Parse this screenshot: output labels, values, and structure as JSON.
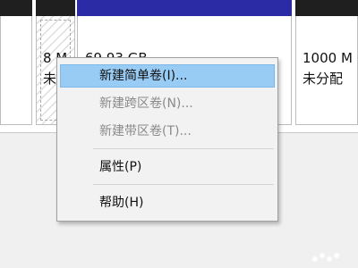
{
  "disk_layout": {
    "partitions": [
      {
        "name": "partition-1",
        "color": "#1f1f1f"
      },
      {
        "name": "partition-2",
        "size_text": "8 M",
        "status_text": "未",
        "color": "#1f1f1f"
      },
      {
        "name": "partition-3",
        "size_text": "69.93 GB",
        "color": "#2b2ba6"
      },
      {
        "name": "partition-4",
        "size_text": "1000 M",
        "status_text": "未分配",
        "color": "#1f1f1f"
      }
    ]
  },
  "context_menu": {
    "items": [
      {
        "label": "新建简单卷(I)...",
        "state": "selected"
      },
      {
        "label": "新建跨区卷(N)...",
        "state": "disabled"
      },
      {
        "label": "新建带区卷(T)...",
        "state": "disabled"
      },
      {
        "label": "属性(P)",
        "state": "normal"
      },
      {
        "label": "帮助(H)",
        "state": "normal"
      }
    ]
  }
}
